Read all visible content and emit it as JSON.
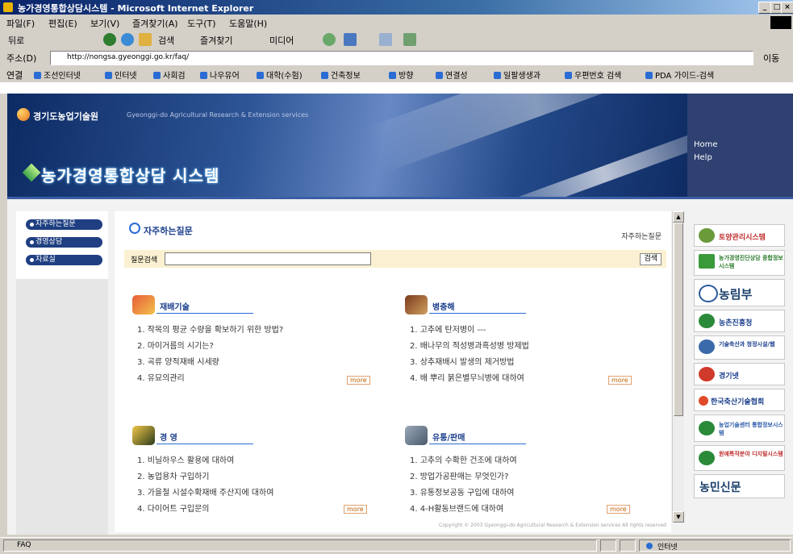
{
  "window": {
    "title": "농가경영통합상담시스템 - Microsoft Internet Explorer",
    "min": "_",
    "max": "□",
    "close": "×"
  },
  "menu": [
    "파일(F)",
    "편집(E)",
    "보기(V)",
    "즐겨찾기(A)",
    "도구(T)",
    "도움말(H)"
  ],
  "toolbar": {
    "back": "뒤로",
    "search": "검색",
    "favorites": "즐겨찾기",
    "media": "미디어"
  },
  "address": {
    "label": "주소(D)",
    "url": "http://nongsa.gyeonggi.go.kr/faq/",
    "go": "이동",
    "links": "연결"
  },
  "links": [
    "조선인터넷",
    "인터넷",
    "사회검",
    "나우유어",
    "대학(수험)",
    "건축정보",
    "방향",
    "연결성",
    "일팔생생과",
    "우편번호 검색",
    "PDA 가이드-검색"
  ],
  "header": {
    "org": "경기도농업기술원",
    "org_en": "Gyeonggi-do Agricultural Research & Extension services",
    "system_title": "농가경영통합상담 시스템",
    "home": "Home",
    "help": "Help"
  },
  "leftnav": [
    "자주하는질문",
    "경영상담",
    "자료실"
  ],
  "main": {
    "title": "자주하는질문",
    "title_link": "자주하는질문",
    "search_label": "질문검색",
    "search_button": "검색",
    "more_label": "more",
    "copyright": "Copyright © 2003 Gyeonggi-do Agricultural Research & Extension services All rights reserved"
  },
  "categories": [
    {
      "name": "재배기술",
      "items": [
        "1. 작목의 평균 수량을 확보하기 위한 방법?",
        "2. 마이거름의 시기는?",
        "3. 곡류 양적재배 시세량",
        "4. 유묘의관리"
      ]
    },
    {
      "name": "병충해",
      "items": [
        "1. 고추에 탄저병이 ---",
        "2. 배나무의 적성병과흑성병 방제법",
        "3. 상추재배시 발생의 제거방법",
        "4. 배 뿌리 붉은별무늬병에 대하여"
      ]
    },
    {
      "name": "경 영",
      "items": [
        "1. 비닐하우스 활용에 대하여",
        "2. 농업용차 구입하기",
        "3. 가을철 시설수확재배 주산지에 대하여",
        "4. 다이어트 구입문의"
      ]
    },
    {
      "name": "유통/판매",
      "items": [
        "1. 고추의 수확한 건조에 대하여",
        "2. 방업가공판매는 무엇인가?",
        "3. 유통정보공동 구입에 대하여",
        "4. 4-H활동브랜드에 대하여"
      ]
    }
  ],
  "right_banners": [
    "토양관리시스템",
    "농가경영진단상담 종합정보시스템",
    "농림부",
    "농촌진흥청",
    "기술축산과 청정시설/웹",
    "경기넷",
    "한국축산기술협회",
    "농업기술센터 통합정보시스템",
    "원예특작분야 디지털시스템",
    "농민신문"
  ],
  "status": {
    "left": "FAQ",
    "zone": "인터넷"
  },
  "colors": {
    "navy": "#1f3f82",
    "accent": "#2a6cd4",
    "search_bg": "#fbf1d2"
  }
}
